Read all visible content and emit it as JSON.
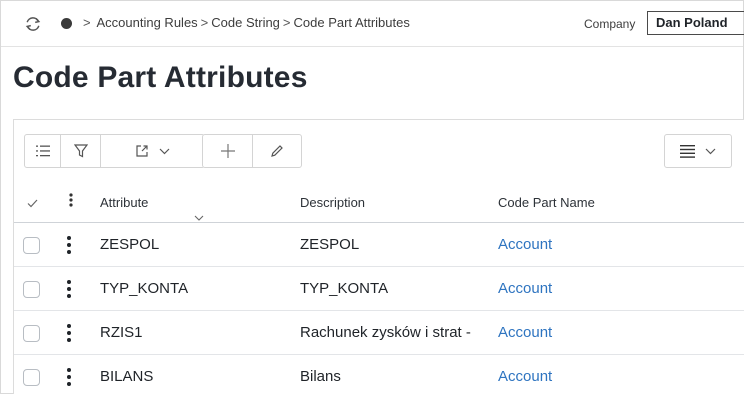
{
  "breadcrumb": {
    "items": [
      "Accounting Rules",
      "Code String",
      "Code Part Attributes"
    ],
    "separator": ">"
  },
  "company": {
    "label": "Company",
    "value": "Dan Poland"
  },
  "page": {
    "title": "Code Part Attributes"
  },
  "table": {
    "columns": [
      "Attribute",
      "Description",
      "Code Part Name"
    ],
    "rows": [
      {
        "attribute": "ZESPOL",
        "description": "ZESPOL",
        "code_part_name": "Account"
      },
      {
        "attribute": "TYP_KONTA",
        "description": "TYP_KONTA",
        "code_part_name": "Account"
      },
      {
        "attribute": "RZIS1",
        "description": "Rachunek zysków i strat -",
        "code_part_name": "Account"
      },
      {
        "attribute": "BILANS",
        "description": "Bilans",
        "code_part_name": "Account"
      }
    ]
  },
  "icons": {
    "refresh": "refresh-icon",
    "home": "home-icon",
    "details": "list-details-icon",
    "filter": "filter-icon",
    "export": "export-icon",
    "add": "plus-icon",
    "edit": "pencil-icon",
    "column_chooser": "column-chooser-icon"
  },
  "colors": {
    "link": "#2e74c0",
    "text": "#1f2328"
  }
}
